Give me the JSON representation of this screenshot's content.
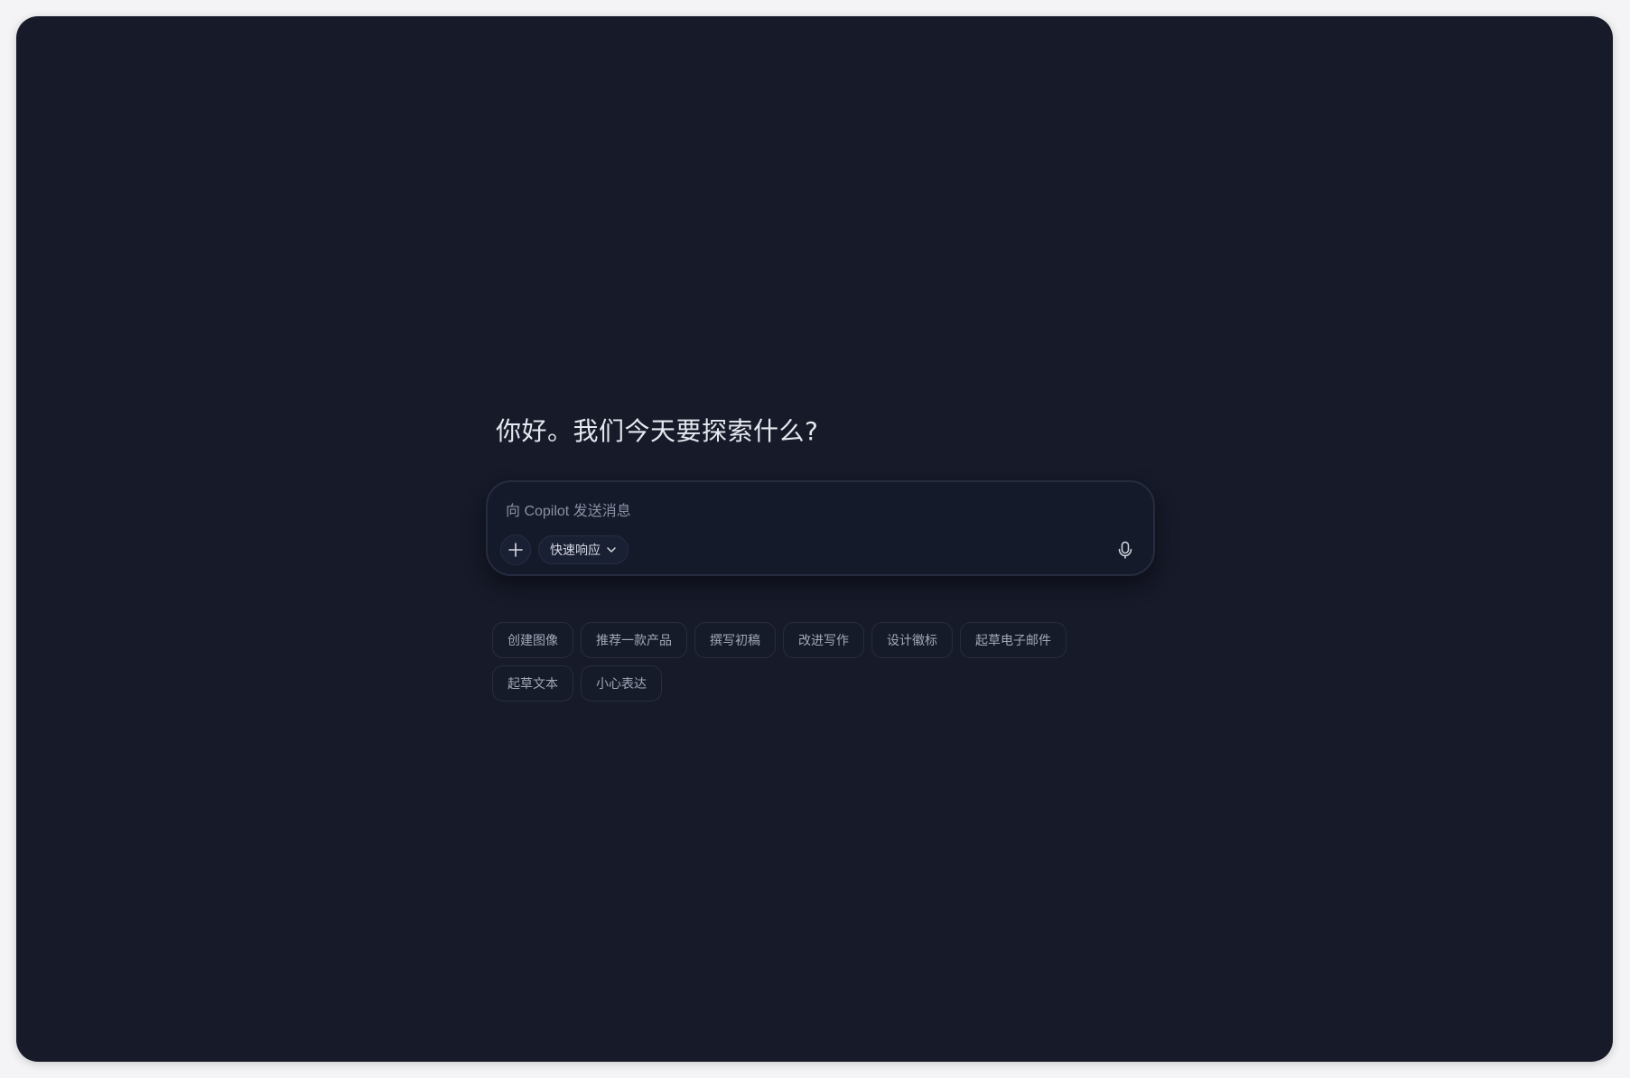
{
  "main": {
    "greeting": "你好。我们今天要探索什么?"
  },
  "composer": {
    "placeholder": "向 Copilot 发送消息",
    "value": "",
    "add_icon": "plus-icon",
    "mode_label": "快速响应",
    "mode_icon": "chevron-down-icon",
    "mic_icon": "microphone-icon"
  },
  "suggestions": [
    {
      "label": "创建图像"
    },
    {
      "label": "推荐一款产品"
    },
    {
      "label": "撰写初稿"
    },
    {
      "label": "改进写作"
    },
    {
      "label": "设计徽标"
    },
    {
      "label": "起草电子邮件"
    },
    {
      "label": "起草文本"
    },
    {
      "label": "小心表达"
    }
  ],
  "colors": {
    "background": "#161a29",
    "text_primary": "#e6e8ef",
    "text_secondary": "#a3a8b8",
    "border": "#272d3e"
  }
}
